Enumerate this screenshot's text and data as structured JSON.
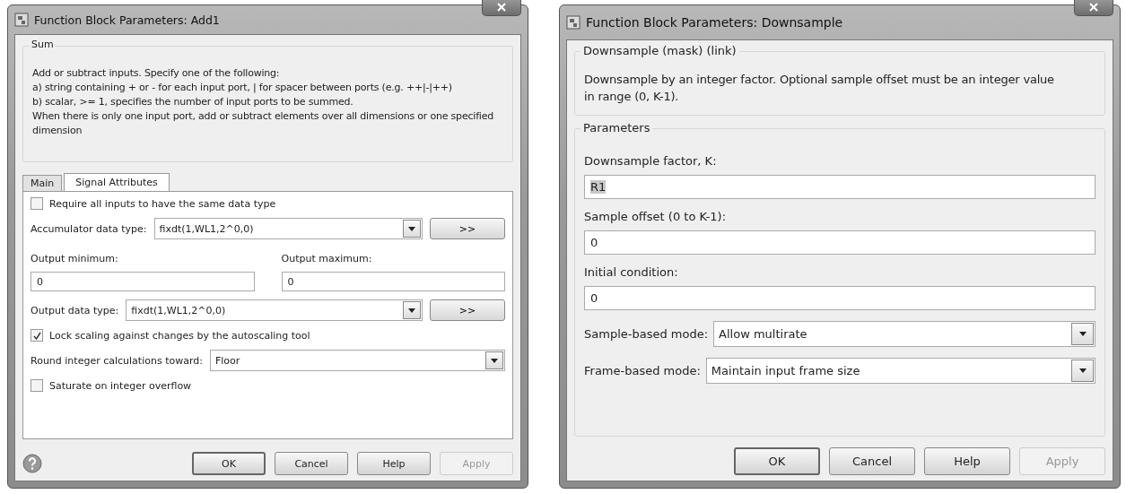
{
  "dialogs": [
    {
      "title": "Function Block Parameters: Add1",
      "group_title": "Sum",
      "description": [
        "Add or subtract inputs.  Specify one of the following:",
        "a) string containing + or - for each input port, | for spacer between ports (e.g. ++|-|++)",
        "b) scalar, >= 1, specifies the number of input ports to be summed.",
        "When there is only one input port, add or subtract elements over all dimensions or one specified dimension"
      ],
      "tabs": [
        {
          "label": "Main",
          "selected": false
        },
        {
          "label": "Signal Attributes",
          "selected": true
        }
      ],
      "rows": [
        {
          "kind": "checkbox",
          "label": "Require all inputs to have the same data type",
          "checked": false
        },
        {
          "kind": "select",
          "label": "Accumulator data type:",
          "value": "fixdt(1,WL1,2^0,0)",
          "button": ">>"
        },
        {
          "kind": "field-pair",
          "fields": [
            {
              "label": "Output minimum:",
              "value": "0"
            },
            {
              "label": "Output maximum:",
              "value": "0"
            }
          ]
        },
        {
          "kind": "select",
          "label": "Output data type:",
          "value": "fixdt(1,WL1,2^0,0)",
          "button": ">>"
        },
        {
          "kind": "checkbox",
          "label": "Lock scaling against changes by the autoscaling tool",
          "checked": true
        },
        {
          "kind": "select",
          "label": "Round integer calculations toward:",
          "value": "Floor"
        },
        {
          "kind": "checkbox",
          "label": "Saturate on integer overflow",
          "checked": false
        }
      ],
      "help": true,
      "buttons": [
        {
          "label": "OK",
          "default": true,
          "disabled": false
        },
        {
          "label": "Cancel",
          "default": false,
          "disabled": false
        },
        {
          "label": "Help",
          "default": false,
          "disabled": false
        },
        {
          "label": "Apply",
          "default": false,
          "disabled": true
        }
      ]
    },
    {
      "title": "Function Block Parameters: Downsample",
      "group_title": "Downsample (mask) (link)",
      "description": [
        "Downsample by an integer  factor.  Optional sample offset must be an integer value",
        "in range (0, K-1)."
      ],
      "params_title": "Parameters",
      "rows": [
        {
          "kind": "field",
          "label": "Downsample factor, K:",
          "value": "R1",
          "selected_text": true
        },
        {
          "kind": "field",
          "label": "Sample offset (0 to K-1):",
          "value": "0",
          "selected_text": false
        },
        {
          "kind": "field",
          "label": "Initial condition:",
          "value": "0",
          "selected_text": false
        },
        {
          "kind": "select",
          "label": "Sample-based mode:",
          "value": "Allow multirate"
        },
        {
          "kind": "select",
          "label": "Frame-based mode:",
          "value": "Maintain input frame size"
        }
      ],
      "help": false,
      "buttons": [
        {
          "label": "OK",
          "default": true,
          "disabled": false
        },
        {
          "label": "Cancel",
          "default": false,
          "disabled": false
        },
        {
          "label": "Help",
          "default": false,
          "disabled": false
        },
        {
          "label": "Apply",
          "default": false,
          "disabled": true
        }
      ]
    }
  ]
}
